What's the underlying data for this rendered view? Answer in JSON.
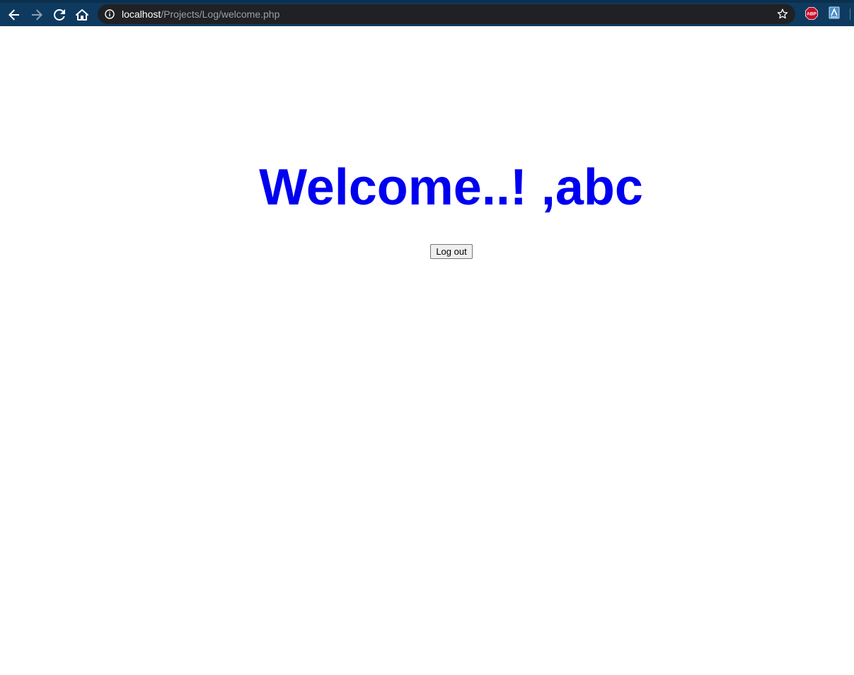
{
  "browser": {
    "url_host": "localhost",
    "url_path": "/Projects/Log/welcome.php",
    "icons": {
      "back": "back-arrow-icon",
      "forward": "forward-arrow-icon",
      "reload": "reload-icon",
      "home": "home-icon",
      "site_info": "info-icon",
      "bookmark": "star-icon",
      "extension_1": "adblock-plus-icon",
      "extension_2": "extension-icon"
    },
    "extension_1_label": "ABP",
    "colors": {
      "toolbar": "#0e3a5f",
      "omnibox": "#202124",
      "abp_red": "#c70d2c"
    }
  },
  "page": {
    "heading": "Welcome..! ,abc",
    "heading_color": "#0000f0",
    "logout_label": "Log out"
  }
}
